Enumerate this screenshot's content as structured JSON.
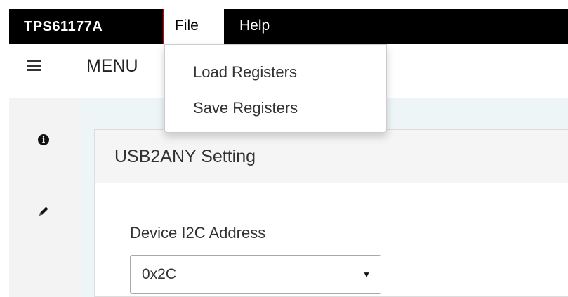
{
  "app": {
    "brand": "TPS61177A"
  },
  "menubar": {
    "file": "File",
    "help": "Help"
  },
  "toolbar": {
    "menu_label": "MENU"
  },
  "file_menu": {
    "items": [
      {
        "label": "Load Registers"
      },
      {
        "label": "Save Registers"
      }
    ]
  },
  "sidebar": {
    "icons": [
      "info-icon",
      "pencil-icon"
    ]
  },
  "panel": {
    "title": "USB2ANY Setting",
    "device_address": {
      "label": "Device I2C Address",
      "value": "0x2C"
    }
  },
  "colors": {
    "topbar": "#000000",
    "brand_separator": "#cc0000",
    "panel_heading": "#f5f5f5"
  }
}
